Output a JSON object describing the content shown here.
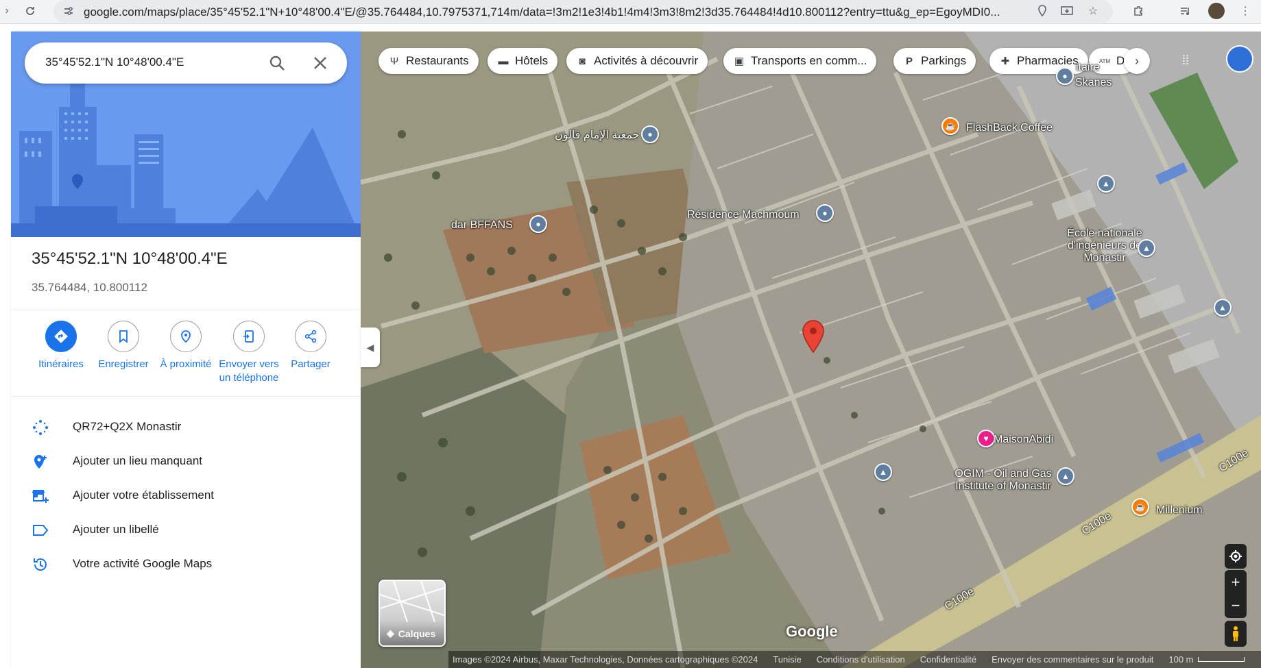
{
  "browser": {
    "url": "google.com/maps/place/35°45'52.1\"N+10°48'00.4\"E/@35.764484,10.7975371,714m/data=!3m2!1e3!4b1!4m4!3m3!8m2!3d35.764484!4d10.800112?entry=ttu&g_ep=EgoyMDI0..."
  },
  "search": {
    "value": "35°45'52.1\"N 10°48'00.4\"E"
  },
  "place": {
    "title": "35°45'52.1\"N 10°48'00.4\"E",
    "coords": "35.764484, 10.800112"
  },
  "actions": [
    {
      "label": "Itinéraires"
    },
    {
      "label": "Enregistrer"
    },
    {
      "label": "À proximité"
    },
    {
      "label": "Envoyer vers un téléphone"
    },
    {
      "label": "Partager"
    }
  ],
  "list": [
    {
      "label": "QR72+Q2X Monastir"
    },
    {
      "label": "Ajouter un lieu manquant"
    },
    {
      "label": "Ajouter votre établissement"
    },
    {
      "label": "Ajouter un libellé"
    },
    {
      "label": "Votre activité Google Maps"
    }
  ],
  "chips": [
    {
      "label": "Restaurants",
      "icon": "fork-knife-icon"
    },
    {
      "label": "Hôtels",
      "icon": "bed-icon"
    },
    {
      "label": "Activités à découvrir",
      "icon": "camera-icon"
    },
    {
      "label": "Transports en comm...",
      "icon": "bus-icon"
    },
    {
      "label": "Parkings",
      "icon": "parking-icon"
    },
    {
      "label": "Pharmacies",
      "icon": "pharmacy-icon"
    },
    {
      "label": "D",
      "icon": "atm-icon"
    }
  ],
  "map_labels": {
    "skanes": "Skanes",
    "itaire": "itaire",
    "flashback": "FlashBack Coffee",
    "jamia": "جمعية الإمام قالون",
    "residence": "Résidence Machmoum",
    "dar": "dar BFFANS",
    "ecole": "École nationale d'ingénieurs de Monastir",
    "maison": "MaisonAbidi",
    "ogim": "OGIM - Oil and Gas Institute of Monastir",
    "millenium": "Millenium",
    "c100e_1": "C100e",
    "c100e_2": "C100e",
    "c100e_3": "C100e",
    "google": "Google"
  },
  "layers": {
    "label": "Calques"
  },
  "footer": {
    "images": "Images ©2024 Airbus, Maxar Technologies, Données cartographiques ©2024",
    "country": "Tunisie",
    "terms": "Conditions d'utilisation",
    "privacy": "Confidentialité",
    "feedback": "Envoyer des commentaires sur le produit",
    "scale": "100 m"
  },
  "colors": {
    "accent": "#1a73e8",
    "pin": "#ea4335",
    "poi_gray": "#5f7ea0",
    "poi_orange": "#f57c00",
    "poi_pink": "#e91e8c"
  }
}
